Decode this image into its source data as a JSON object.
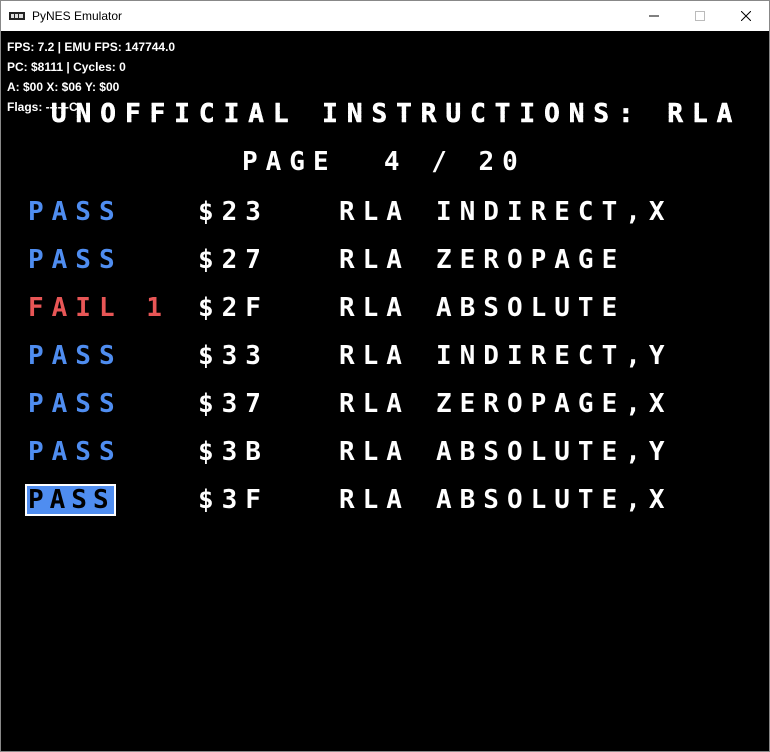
{
  "window": {
    "title": "PyNES Emulator",
    "icon": "pynes-app-icon",
    "controls": [
      "minimize-icon",
      "maximize-icon",
      "close-icon"
    ]
  },
  "overlay": {
    "fps_line": "FPS: 7.2 | EMU FPS: 147744.0",
    "pc_line": "PC: $8111 | Cycles: 0",
    "reg_line": "A: $00 X: $06 Y: $00",
    "flags_line": "Flags: ----I-C"
  },
  "screen": {
    "heading": "UNOFFICIAL INSTRUCTIONS: RLA",
    "page_label": "PAGE  4 / 20",
    "rows": [
      {
        "status": "PASS",
        "opcode": "$23",
        "instruction": "RLA",
        "mode": "INDIRECT,X",
        "result": "pass"
      },
      {
        "status": "PASS",
        "opcode": "$27",
        "instruction": "RLA",
        "mode": "ZEROPAGE",
        "result": "pass"
      },
      {
        "status": "FAIL 1",
        "opcode": "$2F",
        "instruction": "RLA",
        "mode": "ABSOLUTE",
        "result": "fail"
      },
      {
        "status": "PASS",
        "opcode": "$33",
        "instruction": "RLA",
        "mode": "INDIRECT,Y",
        "result": "pass"
      },
      {
        "status": "PASS",
        "opcode": "$37",
        "instruction": "RLA",
        "mode": "ZEROPAGE,X",
        "result": "pass"
      },
      {
        "status": "PASS",
        "opcode": "$3B",
        "instruction": "RLA",
        "mode": "ABSOLUTE,Y",
        "result": "pass"
      },
      {
        "status": "PASS",
        "opcode": "$3F",
        "instruction": "RLA",
        "mode": "ABSOLUTE,X",
        "result": "pass"
      }
    ],
    "selected_row_index": 6
  },
  "colors": {
    "pass": "#4f8df0",
    "fail": "#e85656",
    "text": "#ffffff",
    "background": "#000000"
  }
}
